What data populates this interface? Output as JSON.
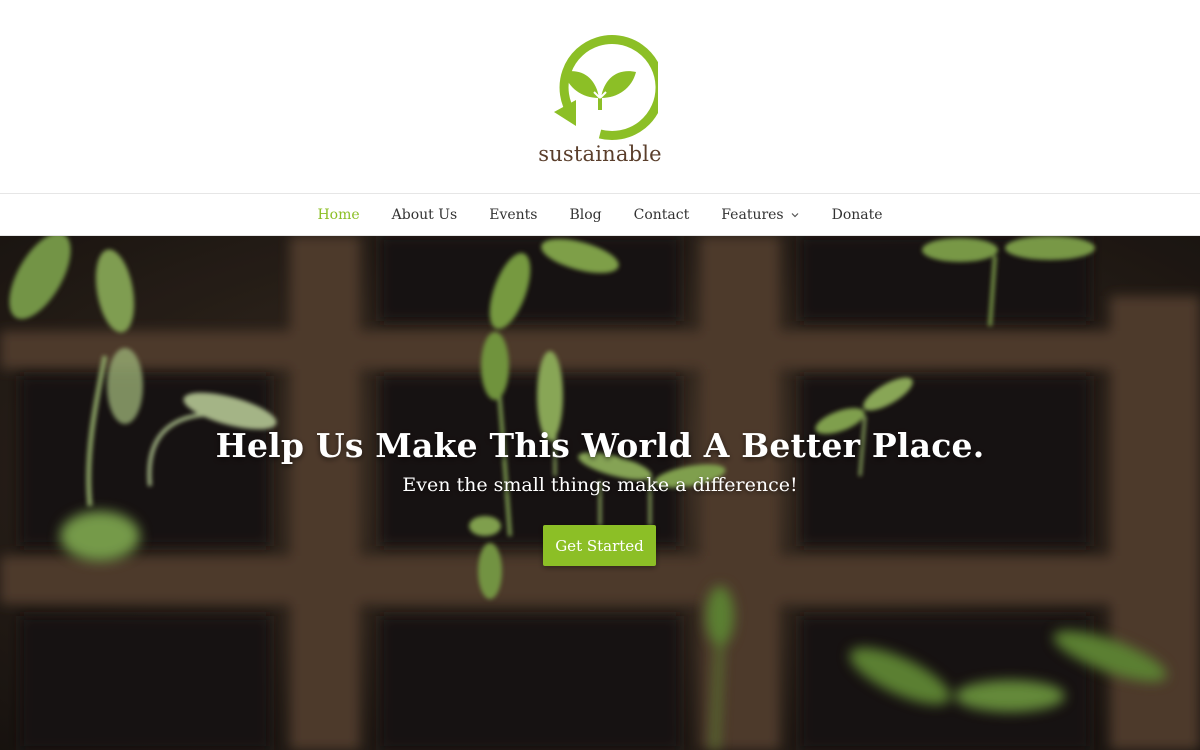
{
  "site": {
    "logo_text": "sustainable",
    "logo_icon": "leaf-recycle-icon",
    "brand_color": "#8cbf26",
    "logo_text_color": "#5a3e2b"
  },
  "nav": {
    "items": [
      {
        "label": "Home",
        "active": true
      },
      {
        "label": "About Us"
      },
      {
        "label": "Events"
      },
      {
        "label": "Blog"
      },
      {
        "label": "Contact"
      },
      {
        "label": "Features",
        "has_dropdown": true
      },
      {
        "label": "Donate"
      }
    ]
  },
  "hero": {
    "title": "Help Us Make This World A Better Place.",
    "subtitle": "Even the small things make a difference!",
    "cta_label": "Get Started"
  }
}
